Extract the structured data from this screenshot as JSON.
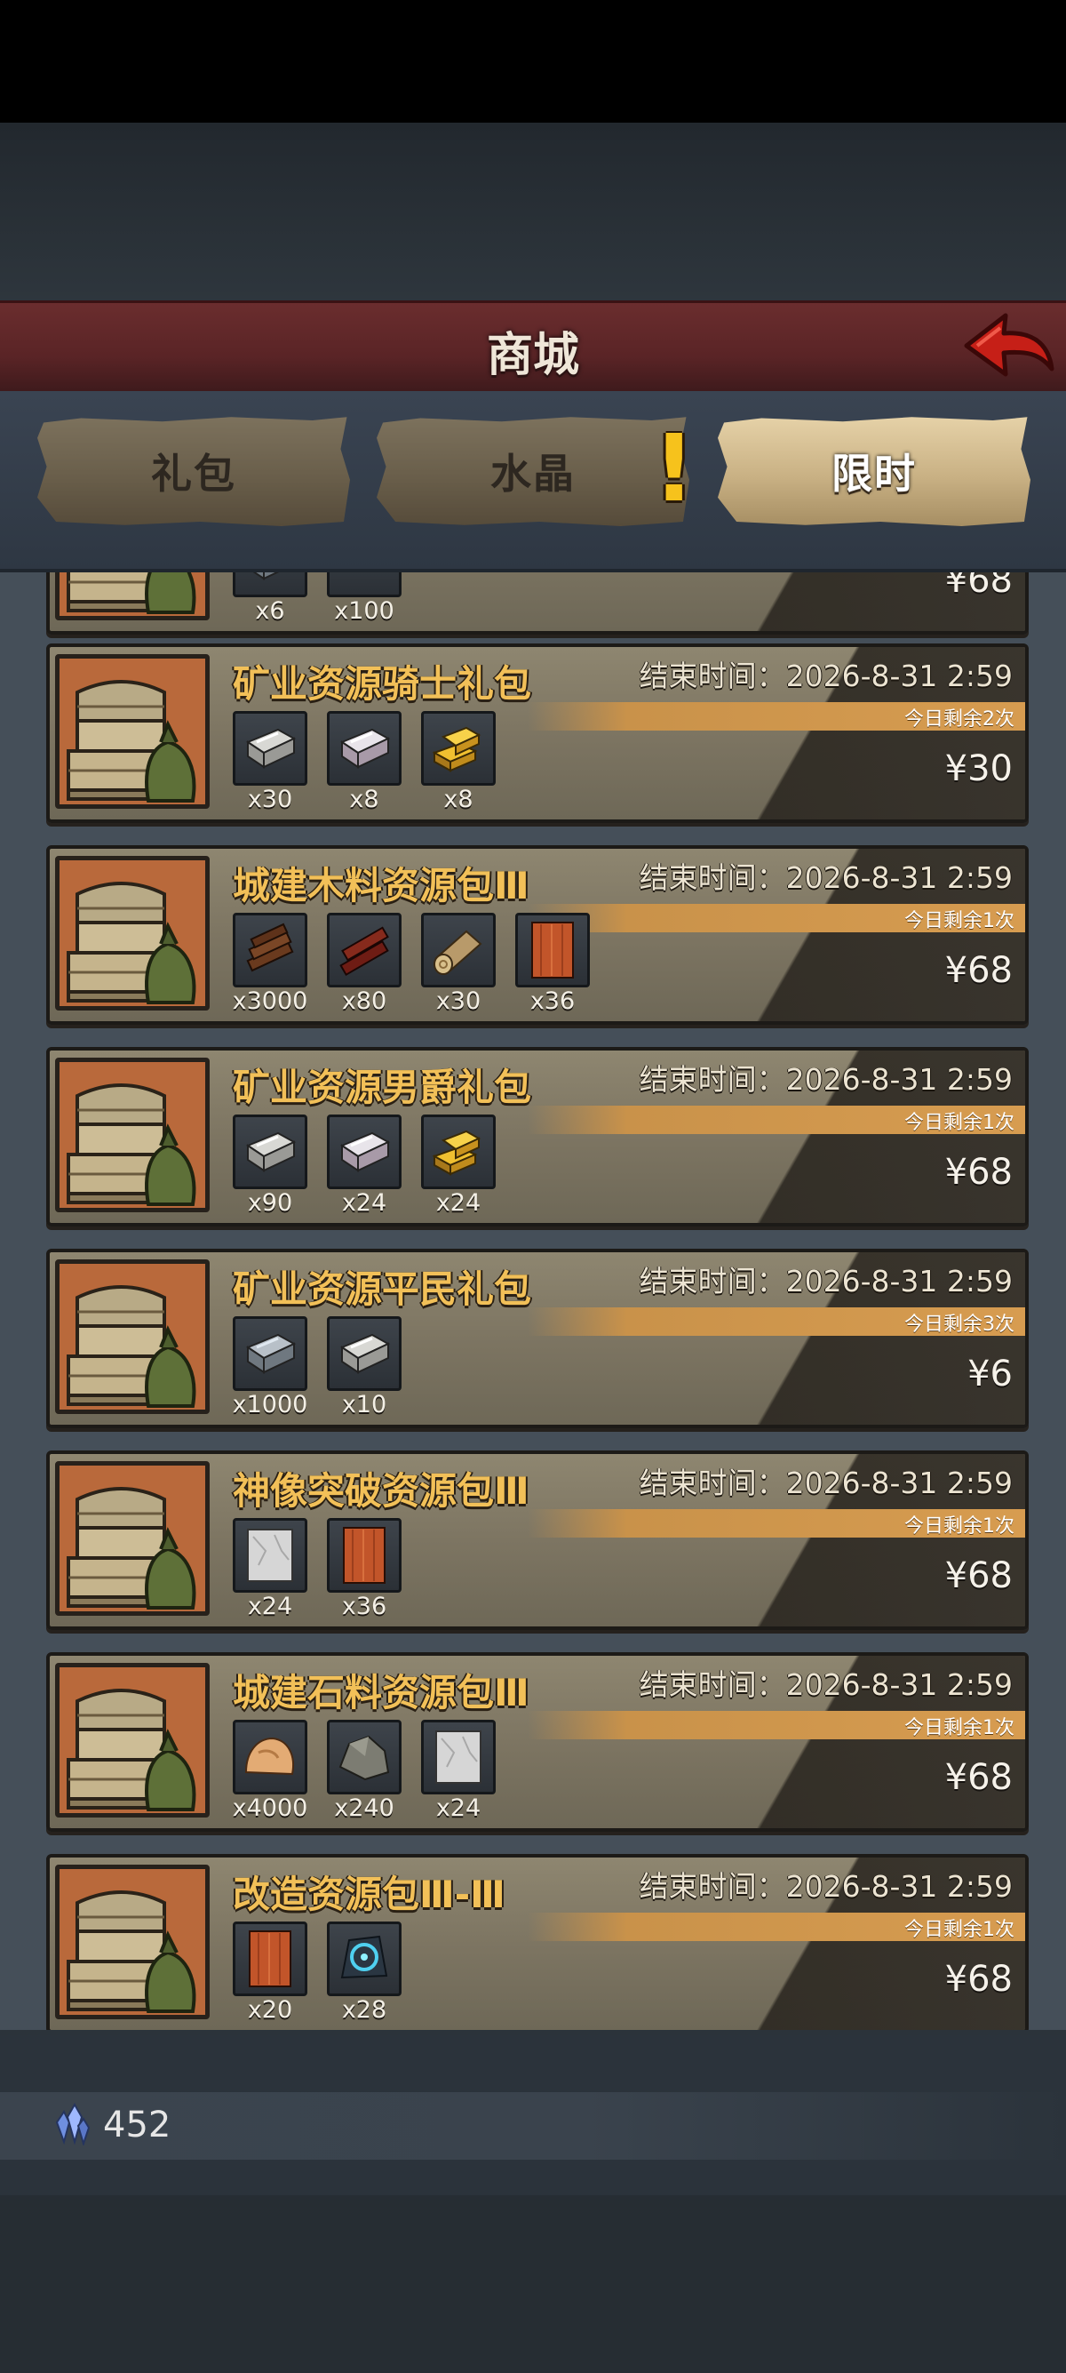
{
  "header": {
    "title": "商城"
  },
  "tabs": [
    {
      "label": "礼包",
      "active": false
    },
    {
      "label": "水晶",
      "active": false,
      "alert": "!"
    },
    {
      "label": "限时",
      "active": true
    }
  ],
  "colors": {
    "title": "#f2c058",
    "remain_bar": "#d79c50",
    "header": "#5a2426"
  },
  "partial_card": {
    "items": [
      {
        "icon": "ore-icon",
        "count": "x6"
      },
      {
        "icon": "wood-icon",
        "count": "x100"
      }
    ],
    "price": "¥68"
  },
  "cards": [
    {
      "title": "矿业资源骑士礼包",
      "end_time": "结束时间：2026-8-31 2:59",
      "remaining": "今日剩余2次",
      "price": "¥30",
      "items": [
        {
          "icon": "silver-ingot-icon",
          "count": "x30"
        },
        {
          "icon": "platinum-ingot-icon",
          "count": "x8"
        },
        {
          "icon": "gold-ingot-icon",
          "count": "x8"
        }
      ]
    },
    {
      "title": "城建木料资源包Ⅲ",
      "end_time": "结束时间：2026-8-31 2:59",
      "remaining": "今日剩余1次",
      "price": "¥68",
      "items": [
        {
          "icon": "wood-pile-icon",
          "count": "x3000"
        },
        {
          "icon": "dark-wood-icon",
          "count": "x80"
        },
        {
          "icon": "log-icon",
          "count": "x30"
        },
        {
          "icon": "plank-icon",
          "count": "x36"
        }
      ]
    },
    {
      "title": "矿业资源男爵礼包",
      "end_time": "结束时间：2026-8-31 2:59",
      "remaining": "今日剩余1次",
      "price": "¥68",
      "items": [
        {
          "icon": "silver-ingot-icon",
          "count": "x90"
        },
        {
          "icon": "platinum-ingot-icon",
          "count": "x24"
        },
        {
          "icon": "gold-ingot-icon",
          "count": "x24"
        }
      ]
    },
    {
      "title": "矿业资源平民礼包",
      "end_time": "结束时间：2026-8-31 2:59",
      "remaining": "今日剩余3次",
      "price": "¥6",
      "items": [
        {
          "icon": "iron-ingot-icon",
          "count": "x1000"
        },
        {
          "icon": "silver-ingot-icon",
          "count": "x10"
        }
      ]
    },
    {
      "title": "神像突破资源包Ⅲ",
      "end_time": "结束时间：2026-8-31 2:59",
      "remaining": "今日剩余1次",
      "price": "¥68",
      "items": [
        {
          "icon": "marble-block-icon",
          "count": "x24"
        },
        {
          "icon": "plank-icon",
          "count": "x36"
        }
      ]
    },
    {
      "title": "城建石料资源包Ⅲ",
      "end_time": "结束时间：2026-8-31 2:59",
      "remaining": "今日剩余1次",
      "price": "¥68",
      "items": [
        {
          "icon": "sandstone-icon",
          "count": "x4000"
        },
        {
          "icon": "rock-icon",
          "count": "x240"
        },
        {
          "icon": "marble-block-icon",
          "count": "x24"
        }
      ]
    },
    {
      "title": "改造资源包Ⅲ-Ⅲ",
      "end_time": "结束时间：2026-8-31 2:59",
      "remaining": "今日剩余1次",
      "price": "¥68",
      "items": [
        {
          "icon": "plank-icon",
          "count": "x20"
        },
        {
          "icon": "rune-stone-icon",
          "count": "x28"
        }
      ]
    }
  ],
  "resource": {
    "icon": "crystal-icon",
    "count": "452"
  }
}
